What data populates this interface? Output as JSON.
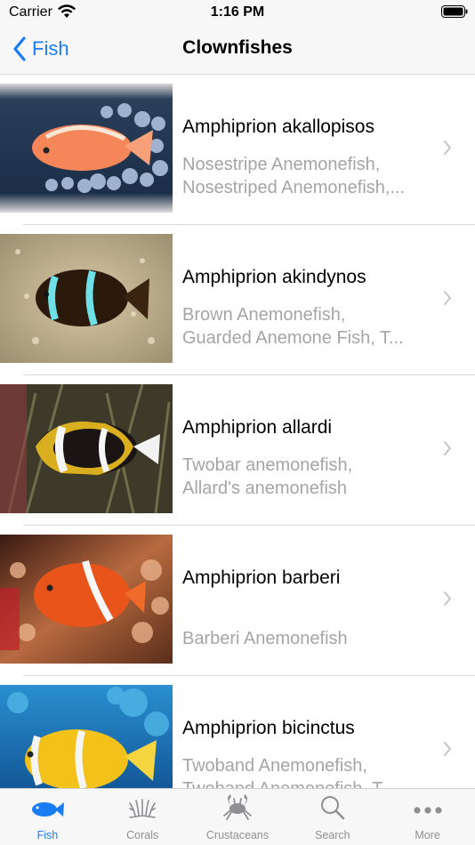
{
  "status_bar": {
    "carrier": "Carrier",
    "time": "1:16 PM"
  },
  "nav": {
    "back_label": "Fish",
    "title": "Clownfishes"
  },
  "rows": [
    {
      "title": "Amphiprion akallopisos",
      "sub1": "Nosestripe Anemonefish,",
      "sub2": "Nosestriped Anemonefish,..."
    },
    {
      "title": "Amphiprion akindynos",
      "sub1": "Brown Anemonefish,",
      "sub2": "Guarded Anemone Fish, T..."
    },
    {
      "title": "Amphiprion allardi",
      "sub1": "Twobar anemonefish,",
      "sub2": "Allard's anemonefish"
    },
    {
      "title": "Amphiprion barberi",
      "sub1": "",
      "sub2": "Barberi Anemonefish"
    },
    {
      "title": "Amphiprion bicinctus",
      "sub1": "Twoband Anemonefish,",
      "sub2": "Twoband Anemonefish, T..."
    }
  ],
  "tabs": [
    {
      "label": "Fish",
      "icon": "fish-icon",
      "active": true
    },
    {
      "label": "Corals",
      "icon": "coral-icon",
      "active": false
    },
    {
      "label": "Crustaceans",
      "icon": "crab-icon",
      "active": false
    },
    {
      "label": "Search",
      "icon": "search-icon",
      "active": false
    },
    {
      "label": "More",
      "icon": "more-icon",
      "active": false
    }
  ],
  "colors": {
    "accent": "#1a7cf5",
    "inactive": "#8e8e93",
    "subtitle": "#a5a5a5"
  }
}
